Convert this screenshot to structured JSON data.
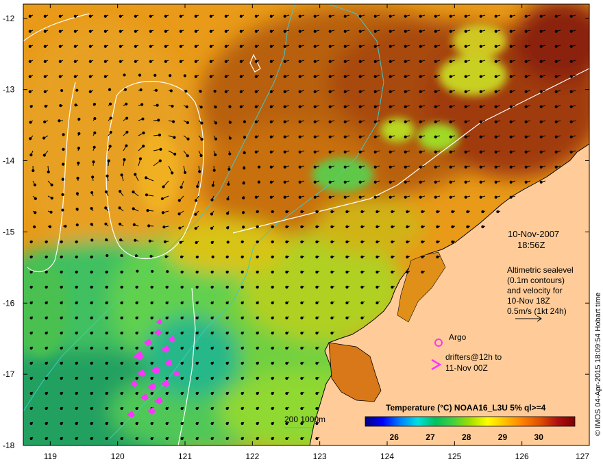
{
  "map": {
    "lon_range": [
      118.6,
      127
    ],
    "lat_range": [
      -18,
      -11.8
    ],
    "lon_ticks": [
      "119",
      "120",
      "121",
      "122",
      "123",
      "124",
      "125",
      "126",
      "127"
    ],
    "lat_ticks": [
      "-12",
      "-13",
      "-14",
      "-15",
      "-16",
      "-17",
      "-18"
    ],
    "land_color": "#ffcc99"
  },
  "annotations": {
    "date": "10-Nov-2007",
    "time": "18:56Z",
    "altimetry_lines": [
      "Altimetric sealevel",
      "(0.1m contours)",
      "and velocity for",
      "10-Nov 18Z",
      "0.5m/s (1kt 24h)"
    ],
    "argo_label": "Argo",
    "drifters_line1": "drifters@12h to",
    "drifters_line2": "11-Nov 00Z",
    "isobath_label": "200  1000m",
    "credit": "© IMOS 04-Apr-2015 18:09:54 Hobart time"
  },
  "colorbar": {
    "title": "Temperature (°C) NOAA16_L3U 5% ql>=4",
    "tick_labels": [
      "26",
      "27",
      "28",
      "29",
      "30"
    ],
    "tick_values": [
      26,
      27,
      28,
      29,
      30
    ],
    "range": [
      25.2,
      31
    ],
    "colors": [
      "#00007f",
      "#0000ff",
      "#0080ff",
      "#00e0e0",
      "#00c060",
      "#40d040",
      "#a0e000",
      "#ffff00",
      "#ffc000",
      "#ff8000",
      "#e05000",
      "#b01010",
      "#7f0000"
    ]
  }
}
